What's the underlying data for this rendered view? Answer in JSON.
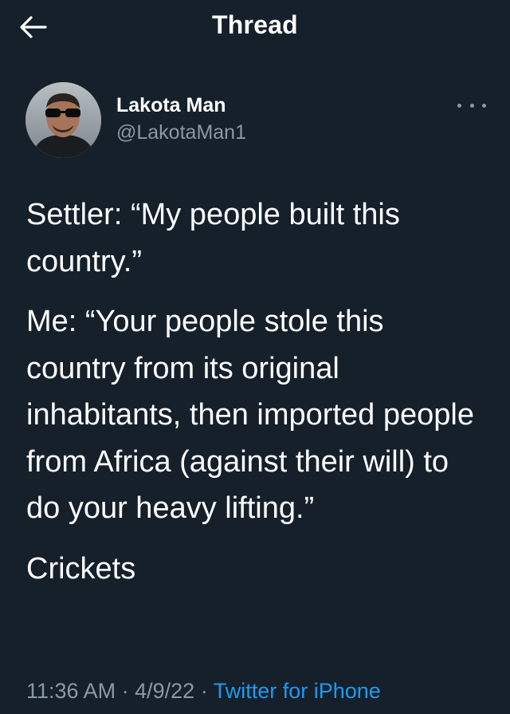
{
  "header": {
    "title": "Thread",
    "back_icon": "arrow-left-icon"
  },
  "author": {
    "name": "Lakota Man",
    "handle": "@LakotaMan1",
    "avatar": "avatar-photo",
    "more_icon": "more-horizontal-icon"
  },
  "tweet": {
    "paragraphs": [
      "Settler: “My people built this country.”",
      "Me: “Your people stole this country from its original inhabitants, then imported people from Africa (against their will) to do your heavy lifting.”",
      "Crickets"
    ]
  },
  "meta": {
    "time": "11:36 AM",
    "date": "4/9/22",
    "separator": "·",
    "source": "Twitter for iPhone"
  },
  "colors": {
    "background": "#15202b",
    "text": "#ffffff",
    "secondary": "#8b98a5",
    "accent": "#1d9bf0"
  }
}
